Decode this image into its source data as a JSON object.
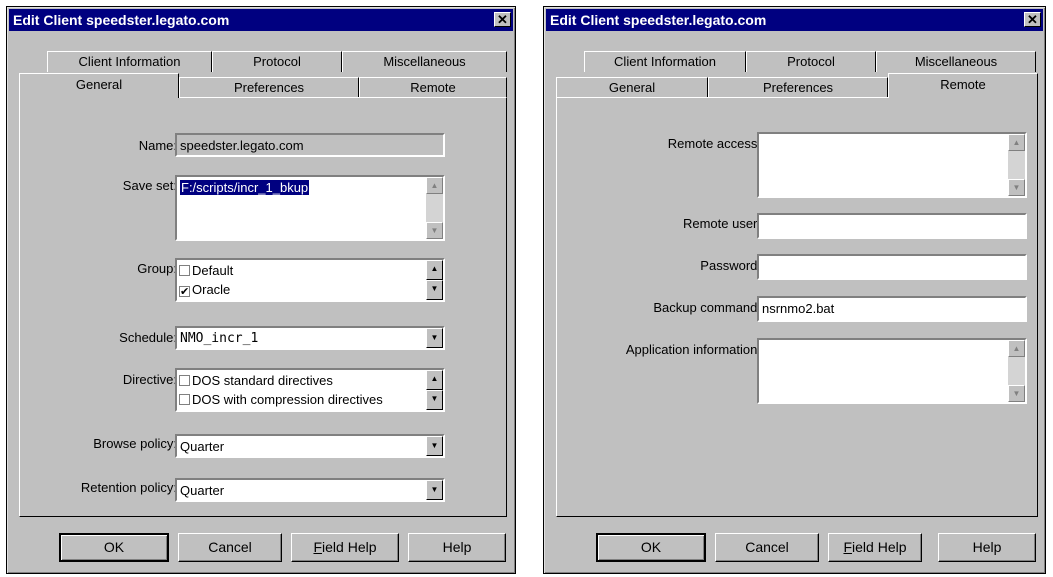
{
  "left": {
    "title": "Edit Client speedster.legato.com",
    "close_glyph": "✕",
    "tabs_back": [
      "Client Information",
      "Protocol",
      "Miscellaneous"
    ],
    "tabs_front": [
      "General",
      "Preferences",
      "Remote"
    ],
    "active_tab": "General",
    "fields": {
      "name_label": "Name:",
      "name_value": "speedster.legato.com",
      "saveset_label": "Save set:",
      "saveset_value": "F:/scripts/incr_1_bkup",
      "group_label": "Group:",
      "group_options": [
        {
          "label": "Default",
          "checked": false
        },
        {
          "label": "Oracle",
          "checked": true
        }
      ],
      "schedule_label": "Schedule:",
      "schedule_value": "NMO_incr_1",
      "directive_label": "Directive:",
      "directive_options": [
        {
          "label": "DOS standard directives",
          "checked": false
        },
        {
          "label": "DOS with compression directives",
          "checked": false
        }
      ],
      "browse_label": "Browse policy:",
      "browse_value": "Quarter",
      "retention_label": "Retention policy:",
      "retention_value": "Quarter"
    },
    "buttons": {
      "ok": "OK",
      "cancel": "Cancel",
      "fieldhelp_hotkey": "F",
      "fieldhelp_rest": "ield Help",
      "help": "Help"
    }
  },
  "right": {
    "title": "Edit Client speedster.legato.com",
    "close_glyph": "✕",
    "tabs_back": [
      "Client Information",
      "Protocol",
      "Miscellaneous"
    ],
    "tabs_front": [
      "General",
      "Preferences",
      "Remote"
    ],
    "active_tab": "Remote",
    "fields": {
      "remote_access_label": "Remote access:",
      "remote_access_value": "",
      "remote_user_label": "Remote user:",
      "remote_user_value": "",
      "password_label": "Password:",
      "password_value": "",
      "backup_command_label": "Backup command:",
      "backup_command_value": "nsrnmo2.bat",
      "app_info_label": "Application information:",
      "app_info_value": ""
    },
    "buttons": {
      "ok": "OK",
      "cancel": "Cancel",
      "fieldhelp_hotkey": "F",
      "fieldhelp_rest": "ield Help",
      "help": "Help"
    }
  },
  "icons": {
    "check": "✔",
    "up": "▲",
    "down": "▼"
  }
}
